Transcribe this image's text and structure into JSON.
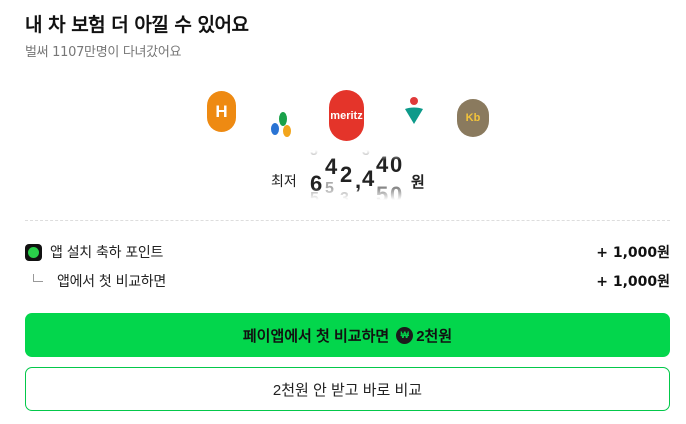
{
  "header": {
    "title": "내 차 보험 더 아낄 수 있어요",
    "subtitle": "벌써 1107만명이 다녀갔어요"
  },
  "insurer_logos": [
    {
      "name": "hyundai-logo",
      "text": "H",
      "color": "#ee8a12"
    },
    {
      "name": "db-logo",
      "text": "",
      "color": "#1aa14a"
    },
    {
      "name": "meritz-logo",
      "text": "meritz",
      "color": "#e4342a"
    },
    {
      "name": "hana-logo",
      "text": "",
      "color": "#0d9a8a"
    },
    {
      "name": "kb-logo",
      "text": "Kb",
      "color": "#8a7a5e"
    }
  ],
  "price": {
    "label": "최저",
    "digits": [
      "6",
      "4",
      "2",
      ",",
      "4",
      "4"
    ],
    "currency": "원"
  },
  "points": [
    {
      "label": "앱 설치 축하 포인트",
      "amount": "+ 1,000원"
    },
    {
      "label": "앱에서 첫 비교하면",
      "amount": "+ 1,000원"
    }
  ],
  "buttons": {
    "primary_prefix": "페이앱에서 첫 비교하면",
    "primary_suffix": "2천원",
    "secondary": "2천원 안 받고 바로 비교"
  },
  "colors": {
    "accent": "#03d64c"
  }
}
